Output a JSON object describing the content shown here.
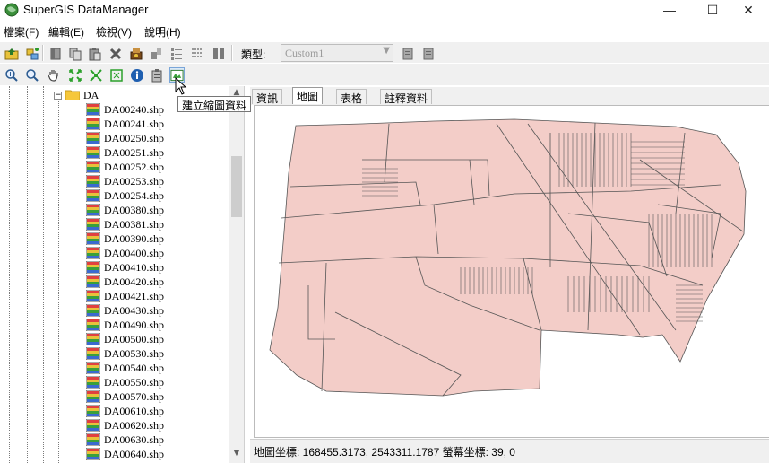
{
  "window": {
    "title": "SuperGIS DataManager",
    "minimize": "—",
    "maximize": "☐",
    "close": "✕"
  },
  "menu": [
    {
      "label": "檔案(F)"
    },
    {
      "label": "編輯(E)"
    },
    {
      "label": "檢視(V)"
    },
    {
      "label": "說明(H)"
    }
  ],
  "toolbar1": {
    "type_label": "類型:",
    "type_select_value": "Custom1"
  },
  "tooltip": "建立縮圖資料",
  "tree": {
    "folder": "DA",
    "files": [
      "DA00240.shp",
      "DA00241.shp",
      "DA00250.shp",
      "DA00251.shp",
      "DA00252.shp",
      "DA00253.shp",
      "DA00254.shp",
      "DA00380.shp",
      "DA00381.shp",
      "DA00390.shp",
      "DA00400.shp",
      "DA00410.shp",
      "DA00420.shp",
      "DA00421.shp",
      "DA00430.shp",
      "DA00490.shp",
      "DA00500.shp",
      "DA00530.shp",
      "DA00540.shp",
      "DA00550.shp",
      "DA00570.shp",
      "DA00610.shp",
      "DA00620.shp",
      "DA00630.shp",
      "DA00640.shp"
    ]
  },
  "tabs": [
    {
      "label": "資訊",
      "active": false
    },
    {
      "label": "地圖",
      "active": true
    },
    {
      "label": "表格",
      "active": false
    },
    {
      "label": "註釋資料",
      "active": false
    }
  ],
  "map": {
    "fill_color": "#f3cdc8",
    "stroke_color": "#555555"
  },
  "status": {
    "text": "地圖坐標: 168455.3173, 2543311.1787 螢幕坐標: 39, 0"
  }
}
